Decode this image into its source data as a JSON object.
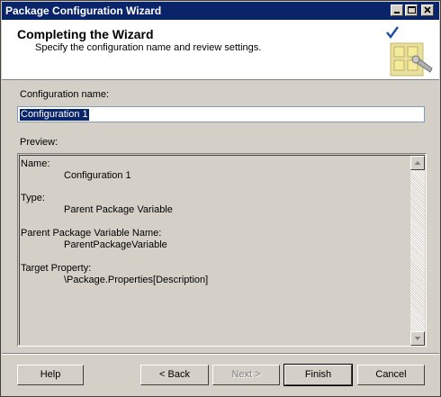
{
  "window": {
    "title": "Package Configuration Wizard"
  },
  "header": {
    "title": "Completing the Wizard",
    "subtitle": "Specify the configuration name and review settings."
  },
  "form": {
    "config_name_label": "Configuration name:",
    "config_name_value": "Configuration 1",
    "preview_label": "Preview:"
  },
  "preview": {
    "name_label": "Name:",
    "name_value": "Configuration 1",
    "type_label": "Type:",
    "type_value": "Parent Package Variable",
    "ppv_label": "Parent Package Variable Name:",
    "ppv_value": "ParentPackageVariable",
    "target_label": "Target Property:",
    "target_value": "\\Package.Properties[Description]"
  },
  "buttons": {
    "help": "Help",
    "back": "< Back",
    "next": "Next >",
    "finish": "Finish",
    "cancel": "Cancel"
  },
  "icons": {
    "minimize": "minimize-icon",
    "maximize": "maximize-icon",
    "close": "close-icon",
    "wizard": "wizard-checkmark-icon",
    "scroll_up": "scroll-up-arrow-icon",
    "scroll_down": "scroll-down-arrow-icon"
  },
  "colors": {
    "titlebar": "#0a246a",
    "selection": "#0a246a",
    "face": "#d4d0c8"
  }
}
